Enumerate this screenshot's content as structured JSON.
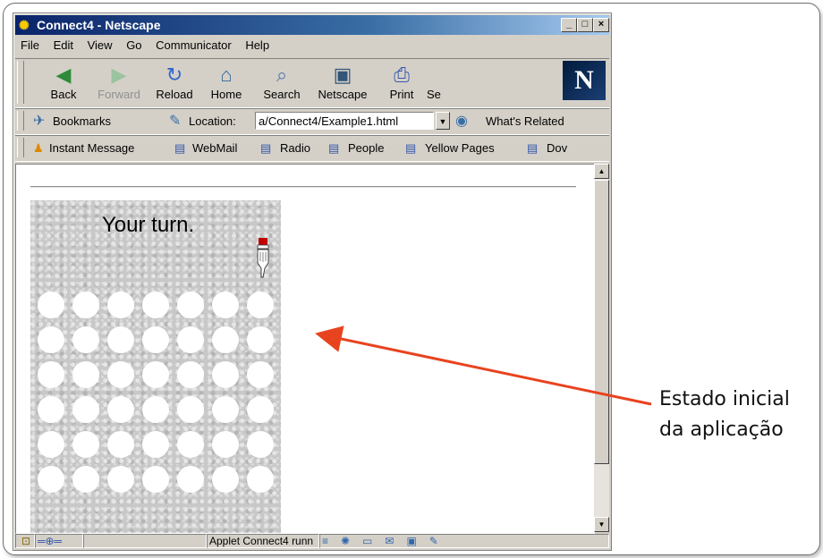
{
  "window": {
    "title": "Connect4 - Netscape",
    "min": "_",
    "max": "□",
    "close": "×"
  },
  "menu": [
    {
      "label": "File"
    },
    {
      "label": "Edit"
    },
    {
      "label": "View"
    },
    {
      "label": "Go"
    },
    {
      "label": "Communicator"
    },
    {
      "label": "Help"
    }
  ],
  "nav": {
    "back": "Back",
    "forward": "Forward",
    "reload": "Reload",
    "home": "Home",
    "search": "Search",
    "netscape": "Netscape",
    "print": "Print",
    "security": "Se",
    "logo": "N"
  },
  "location": {
    "bookmarks": "Bookmarks",
    "label": "Location:",
    "url": "a/Connect4/Example1.html",
    "related": "What's Related"
  },
  "personal": {
    "instant": "Instant Message",
    "webmail": "WebMail",
    "radio": "Radio",
    "people": "People",
    "yellow": "Yellow Pages",
    "dov": "Dov"
  },
  "applet": {
    "status": "Your turn."
  },
  "statusbar": {
    "text": "Applet Connect4 runn"
  },
  "annotation": {
    "line1": "Estado inicial",
    "line2": "da aplicação"
  },
  "board": {
    "columns": 7,
    "rows": 6
  }
}
